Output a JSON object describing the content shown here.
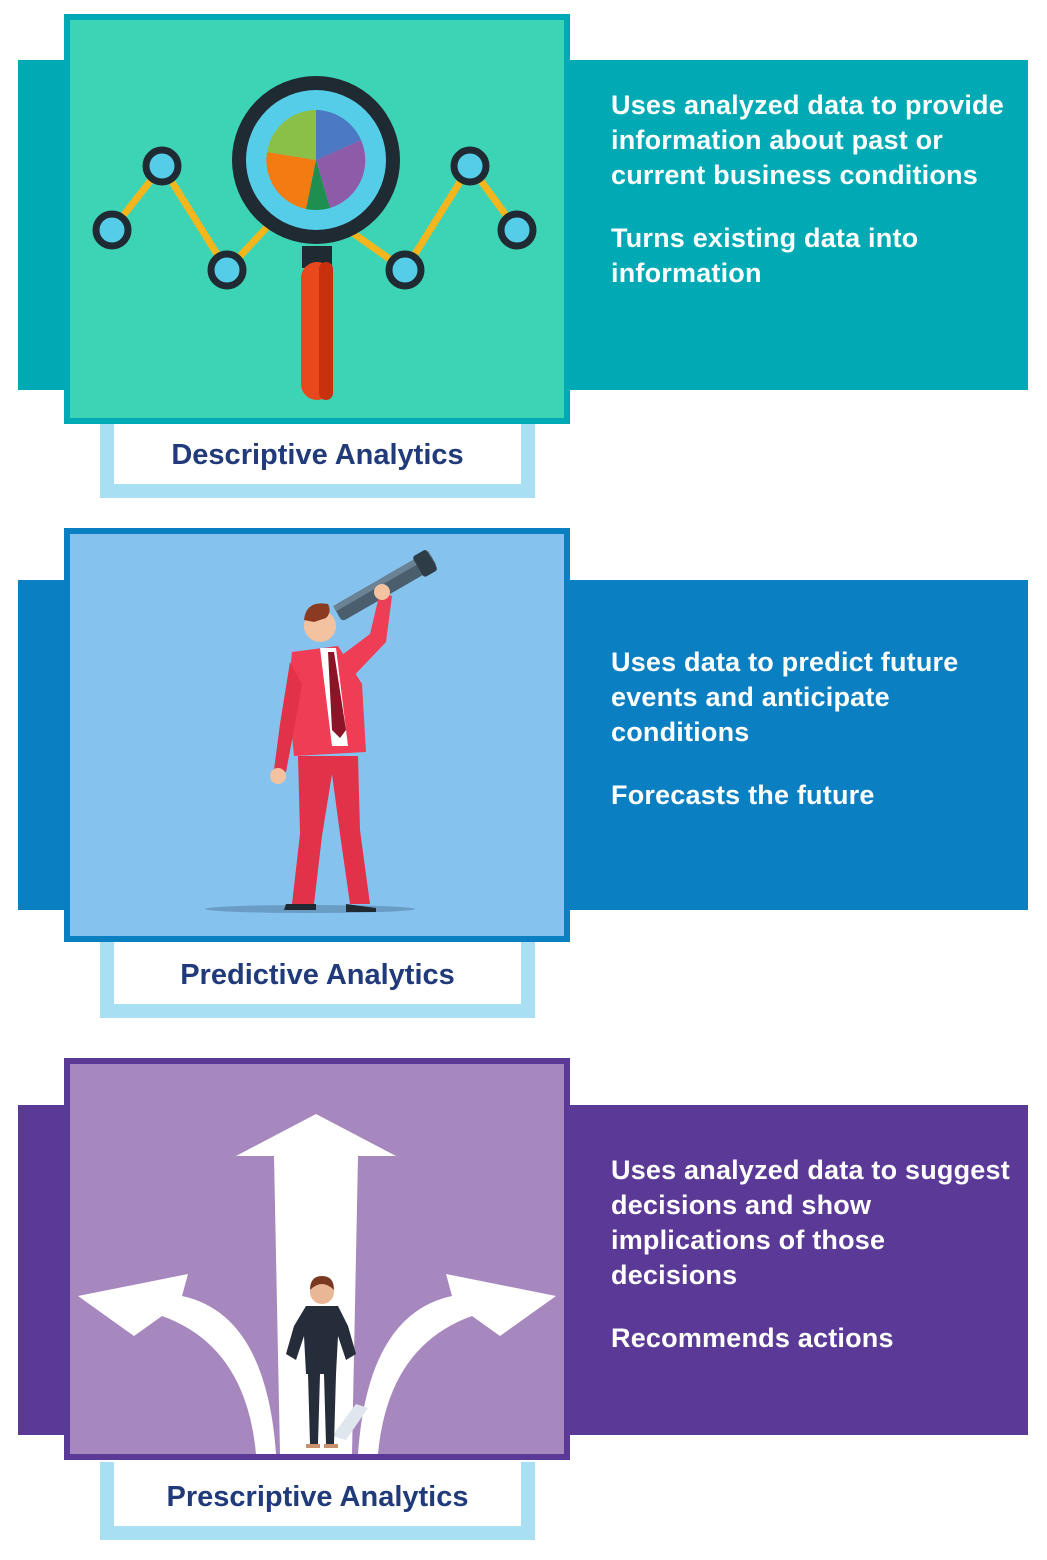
{
  "colors": {
    "descriptive_band": "#00aab5",
    "descriptive_frame_bg": "#3dd4b5",
    "descriptive_frame_border": "#00aab5",
    "predictive_band": "#0a7fc2",
    "predictive_frame_bg": "#85c3ee",
    "predictive_frame_border": "#0a7fc2",
    "prescriptive_band": "#5a3a96",
    "prescriptive_frame_bg": "#a788be",
    "prescriptive_frame_border": "#5a3a96",
    "label_border": "#a8dff2",
    "label_text": "#213a7a"
  },
  "sections": [
    {
      "label": "Descriptive Analytics",
      "illustration": "magnifier-pie-chart-icon",
      "points": [
        "Uses analyzed data to provide information about past or current business conditions",
        "Turns existing data into information"
      ]
    },
    {
      "label": "Predictive Analytics",
      "illustration": "businessman-telescope-icon",
      "points": [
        "Uses data to predict future events and anticipate conditions",
        "Forecasts the future"
      ]
    },
    {
      "label": "Prescriptive Analytics",
      "illustration": "crossroads-arrows-icon",
      "points": [
        "Uses analyzed data to suggest decisions and show implications of those decisions",
        "Recommends actions"
      ]
    }
  ]
}
